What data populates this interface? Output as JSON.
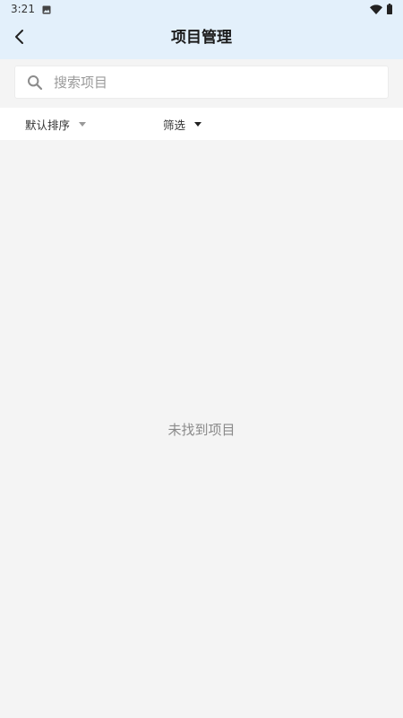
{
  "status_bar": {
    "time": "3:21",
    "icons": [
      "image-icon",
      "wifi-icon",
      "battery-icon"
    ]
  },
  "header": {
    "title": "项目管理",
    "back_icon": "chevron-left-icon"
  },
  "search": {
    "placeholder": "搜索项目",
    "value": "",
    "icon": "search-icon"
  },
  "filters": {
    "sort_label": "默认排序",
    "screen_label": "筛选"
  },
  "empty_state": {
    "message": "未找到项目"
  },
  "colors": {
    "header_bg": "#e3f0fb",
    "page_bg": "#f4f4f4",
    "muted_text": "#8a8a8a"
  }
}
